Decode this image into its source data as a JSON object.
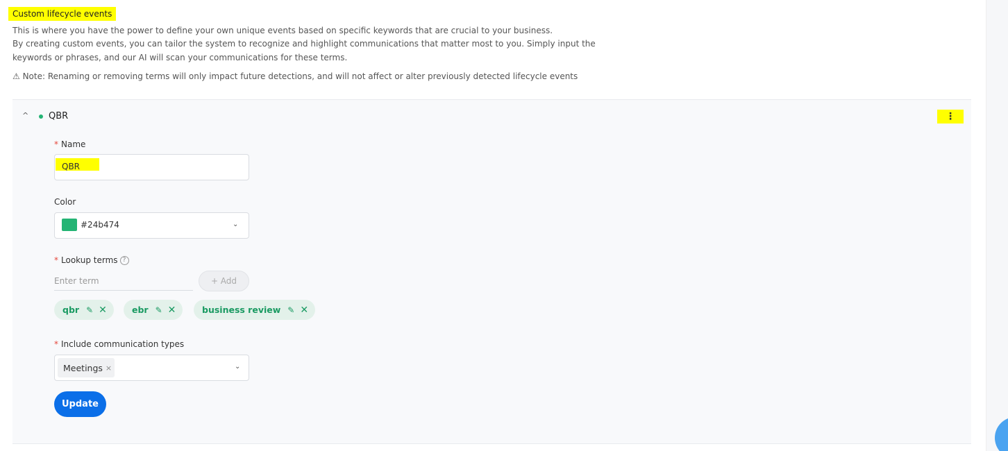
{
  "section": {
    "title": "Custom lifecycle events",
    "description": [
      "This is where you have the power to define your own unique events based on specific keywords that are crucial to your business.",
      "By creating custom events, you can tailor the system to recognize and highlight communications that matter most to you. Simply input the",
      "keywords or phrases, and our AI will scan your communications for these terms."
    ],
    "note": "⚠ Note: Renaming or removing terms will only impact future detections, and will not affect or alter previously detected lifecycle events"
  },
  "event": {
    "title": "QBR",
    "dot_color": "#24b474",
    "more_icon": "⋮",
    "expand_icon": "^",
    "fields": {
      "name_required": "*",
      "name_label": "Name",
      "name_value": "QBR",
      "color_label": "Color",
      "color_value": "#24b474",
      "terms_required": "*",
      "terms_label": "Lookup terms",
      "terms_help": "?",
      "term_placeholder": "Enter term",
      "add_label": "+ Add",
      "terms": [
        "qbr",
        "ebr",
        "business review"
      ],
      "comm_required": "*",
      "comm_label": "Include communication types",
      "comm_tags": [
        "Meetings"
      ]
    },
    "update_label": "Update"
  },
  "icons": {
    "chevron_down": "⌄",
    "edit": "✎",
    "close": "✕",
    "tag_close": "×"
  },
  "colors": {
    "accent_green": "#1a9a62",
    "chip_bg": "#e3f1ea",
    "primary_blue": "#0b6fe8",
    "highlight": "#ffff00"
  }
}
